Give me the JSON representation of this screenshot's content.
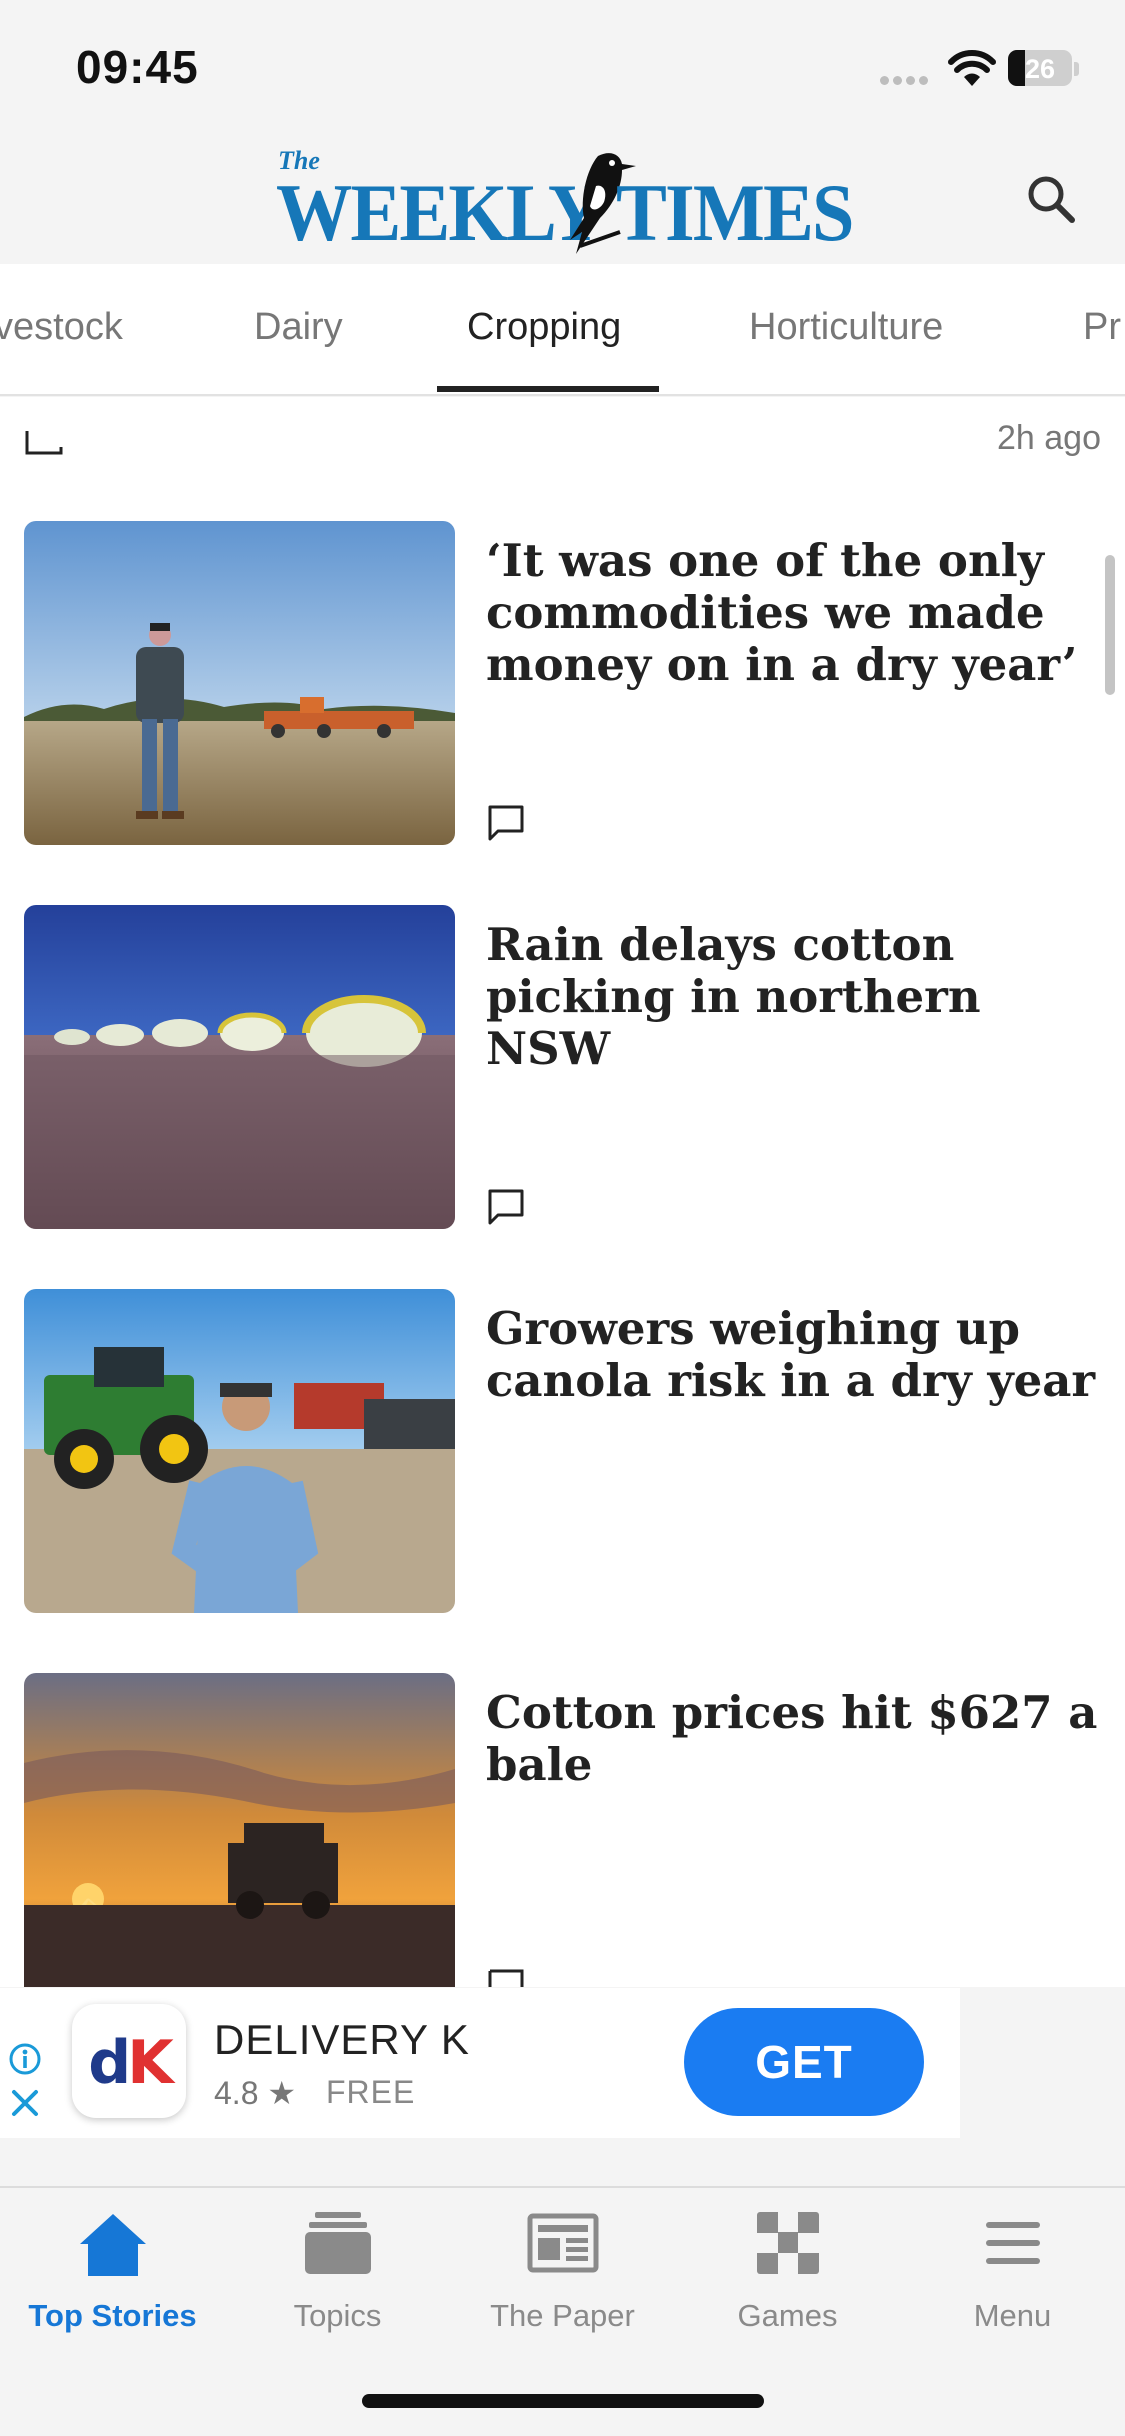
{
  "status_bar": {
    "time": "09:45",
    "battery_percent": "26",
    "battery_level": 0.26
  },
  "header": {
    "logo_small": "The",
    "logo_word_left": "WEEKLY",
    "logo_word_right": "TIMES",
    "search_icon": "search-icon",
    "brand_color": "#1677b8"
  },
  "tabs": {
    "items": [
      {
        "label": "vestock"
      },
      {
        "label": "Dairy"
      },
      {
        "label": "Cropping"
      },
      {
        "label": "Horticulture"
      },
      {
        "label": "Pr"
      }
    ],
    "active_index": 2
  },
  "feed": {
    "previous_item_timestamp": "2h ago",
    "articles": [
      {
        "headline": "‘It was one of the only commodities we made money on in a dry year’",
        "image": "farmer-in-field-with-seeder"
      },
      {
        "headline": "Rain delays cotton picking in northern NSW",
        "image": "cotton-field-with-round-bales"
      },
      {
        "headline": "Growers weighing up canola risk in a dry year",
        "image": "farmer-with-green-tractor"
      },
      {
        "headline": "Cotton prices hit $627 a bale",
        "image": "cotton-picker-at-sunset"
      }
    ]
  },
  "ad": {
    "app_name": "DELIVERY K",
    "rating": "4.8 ★",
    "price": "FREE",
    "cta": "GET",
    "icon_letters_d": "d",
    "icon_letters_k": "K",
    "cta_color": "#1a7cf2"
  },
  "bottom_nav": {
    "items": [
      {
        "label": "Top Stories",
        "icon": "home-icon"
      },
      {
        "label": "Topics",
        "icon": "stack-icon"
      },
      {
        "label": "The Paper",
        "icon": "newspaper-icon"
      },
      {
        "label": "Games",
        "icon": "checker-icon"
      },
      {
        "label": "Menu",
        "icon": "hamburger-icon"
      }
    ],
    "active_index": 0,
    "active_color": "#1677d6"
  }
}
